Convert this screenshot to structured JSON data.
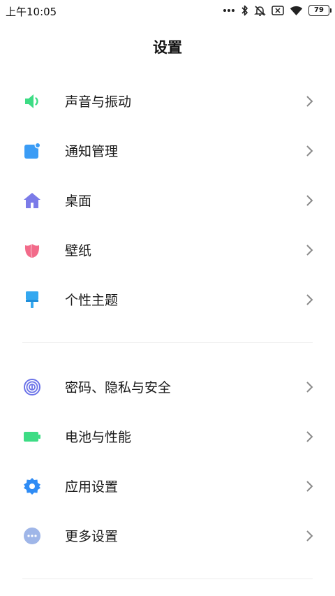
{
  "status_bar": {
    "time": "上午10:05",
    "battery_level": "79"
  },
  "header": {
    "title": "设置"
  },
  "group1": [
    {
      "label": "声音与振动",
      "icon": "speaker-icon",
      "color": "#3ddc84"
    },
    {
      "label": "通知管理",
      "icon": "notification-icon",
      "color": "#3b9cf5"
    },
    {
      "label": "桌面",
      "icon": "home-icon",
      "color": "#7b7be8"
    },
    {
      "label": "壁纸",
      "icon": "tulip-icon",
      "color": "#f26b8a"
    },
    {
      "label": "个性主题",
      "icon": "brush-icon",
      "color": "#34a8f0"
    }
  ],
  "group2": [
    {
      "label": "密码、隐私与安全",
      "icon": "fingerprint-icon",
      "color": "#6b73e8"
    },
    {
      "label": "电池与性能",
      "icon": "battery-icon",
      "color": "#3ddc84"
    },
    {
      "label": "应用设置",
      "icon": "gear-icon",
      "color": "#2f8cf5"
    },
    {
      "label": "更多设置",
      "icon": "more-icon",
      "color": "#9fb6e8"
    }
  ]
}
